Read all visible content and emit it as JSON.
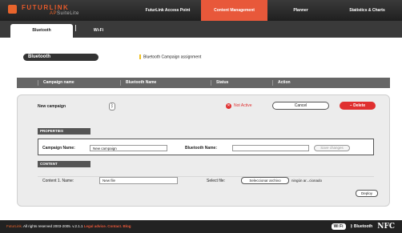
{
  "brand": {
    "name": "FUTURLINK",
    "sub_prefix": "AP",
    "sub_suffix": "SuiteLite"
  },
  "nav": [
    "FuturLink Access Point",
    "Content Management",
    "Planner",
    "Statistics & Charts"
  ],
  "nav_active": 1,
  "tabs": {
    "bluetooth": "Bluetooth",
    "wifi": "Wi-Fi"
  },
  "section": {
    "title": "Bluetooth",
    "subtitle": "Bluetooth Campaign assignment"
  },
  "table": {
    "headers": [
      "Campaign name",
      "Bluetooth Name",
      "Status",
      "Action"
    ]
  },
  "campaign": {
    "name": "New campaign",
    "status": "Not Active",
    "cancel": "Cancel",
    "delete": "Delete"
  },
  "properties": {
    "section_label": "PROPERTIES",
    "campaign_name_label": "Campaign Name:",
    "campaign_name_value": "New campaign",
    "bluetooth_name_label": "Bluetooth Name:",
    "bluetooth_name_value": "",
    "save_label": "Save changes"
  },
  "content": {
    "section_label": "CONTENT",
    "content_label": "Content 1. Name:",
    "content_value": "New file",
    "select_file_label": "Select file:",
    "choose_button": "Seleccionar archivo",
    "no_file": "ningún ar...cionado",
    "deploy": "Deploy"
  },
  "footer": {
    "brand": "FuturLink",
    "copyright": ". All rights reserved 2003-2005. v.2.1.1",
    "links": [
      "Legal advice.",
      "Contact.",
      "Blog"
    ],
    "badges": {
      "wifi": "Wi Fi",
      "bt": "Bluetooth",
      "nfc": "NFC"
    }
  },
  "colors": {
    "accent": "#e8583a",
    "danger": "#e03030",
    "dark": "#333333"
  }
}
